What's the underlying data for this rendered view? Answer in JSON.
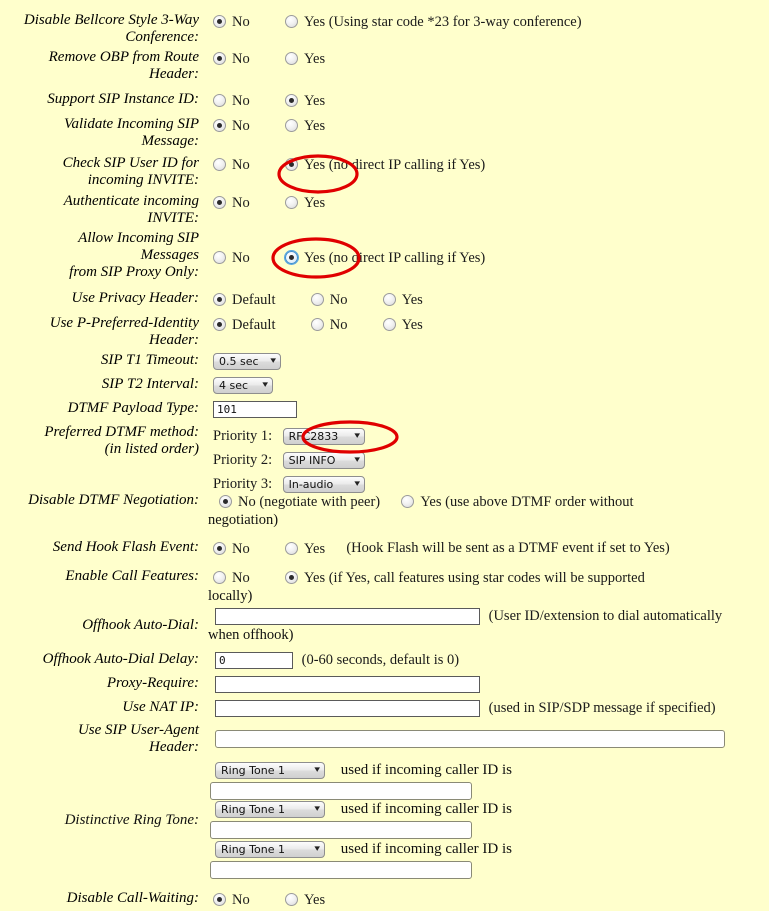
{
  "page": {
    "background_color": "#ffffcc",
    "accent_annotation_color": "#e00000",
    "focus_ring_color": "#3d8fd1"
  },
  "options": {
    "no": "No",
    "yes": "Yes",
    "default": "Default"
  },
  "rows": {
    "disable_bellcore_3way": {
      "label_lines": [
        "Disable Bellcore Style 3-Way",
        "Conference:"
      ],
      "no": "No",
      "yes": "Yes (Using star code *23 for 3-way conference)",
      "selected": "No"
    },
    "remove_obp": {
      "label_lines": [
        "Remove OBP from Route",
        "Header:"
      ],
      "no": "No",
      "yes": "Yes",
      "selected": "No"
    },
    "support_sip_instance_id": {
      "label_lines": [
        "Support SIP Instance ID:"
      ],
      "no": "No",
      "yes": "Yes",
      "selected": "Yes"
    },
    "validate_incoming_sip": {
      "label_lines": [
        "Validate Incoming SIP",
        "Message:"
      ],
      "no": "No",
      "yes": "Yes",
      "selected": "No"
    },
    "check_sip_user_id": {
      "label_lines": [
        "Check SIP User ID for",
        "incoming INVITE:"
      ],
      "no": "No",
      "yes": "Yes (no direct IP calling if Yes)",
      "selected": "Yes",
      "annotated": "true"
    },
    "authenticate_incoming_invite": {
      "label_lines": [
        "Authenticate incoming",
        "INVITE:"
      ],
      "no": "No",
      "yes": "Yes",
      "selected": "No"
    },
    "allow_incoming_sip_messages": {
      "label_lines": [
        "Allow Incoming SIP",
        "Messages",
        "from SIP Proxy Only:"
      ],
      "no": "No",
      "yes": "Yes (no direct IP calling if Yes)",
      "selected": "Yes",
      "annotated": "true",
      "focused": "true"
    },
    "use_privacy_header": {
      "label_lines": [
        "Use Privacy Header:"
      ],
      "default": "Default",
      "no": "No",
      "yes": "Yes",
      "selected": "Default"
    },
    "use_p_preferred_identity": {
      "label_lines": [
        "Use P-Preferred-Identity",
        "Header:"
      ],
      "default": "Default",
      "no": "No",
      "yes": "Yes",
      "selected": "Default"
    },
    "sip_t1_timeout": {
      "label_lines": [
        "SIP T1 Timeout:"
      ],
      "value": "0.5 sec"
    },
    "sip_t2_interval": {
      "label_lines": [
        "SIP T2 Interval:"
      ],
      "value": "4 sec"
    },
    "dtmf_payload_type": {
      "label_lines": [
        "DTMF Payload Type:"
      ],
      "value": "101"
    },
    "preferred_dtmf_method": {
      "label_lines": [
        "Preferred DTMF method:",
        "(in listed order)"
      ],
      "priority1_label": "Priority 1:",
      "priority1_value": "RFC2833",
      "priority2_label": "Priority 2:",
      "priority2_value": "SIP INFO",
      "priority3_label": "Priority 3:",
      "priority3_value": "In-audio",
      "annotated": "true"
    },
    "disable_dtmf_negotiation": {
      "label_lines": [
        "Disable DTMF Negotiation:"
      ],
      "no": "No (negotiate with peer)",
      "yes": "Yes (use above DTMF order without",
      "yes_wrap": "negotiation)",
      "selected": "No"
    },
    "send_hook_flash_event": {
      "label_lines": [
        "Send Hook Flash Event:"
      ],
      "no": "No",
      "yes": "Yes",
      "note": "(Hook Flash will be sent as a DTMF event if set to Yes)",
      "selected": "No"
    },
    "enable_call_features": {
      "label_lines": [
        "Enable Call Features:"
      ],
      "no": "No",
      "yes": "Yes (if Yes, call features using star codes will be supported",
      "yes_wrap": "locally)",
      "selected": "Yes"
    },
    "offhook_auto_dial": {
      "label_lines": [
        "Offhook Auto-Dial:"
      ],
      "value": "",
      "note": "(User ID/extension to dial automatically",
      "note_wrap": "when offhook)"
    },
    "offhook_auto_dial_delay": {
      "label_lines": [
        "Offhook Auto-Dial Delay:"
      ],
      "value": "0",
      "note": "(0-60 seconds, default is 0)"
    },
    "proxy_require": {
      "label_lines": [
        "Proxy-Require:"
      ],
      "value": ""
    },
    "use_nat_ip": {
      "label_lines": [
        "Use NAT IP:"
      ],
      "value": "",
      "note": "(used in SIP/SDP message if specified)"
    },
    "use_sip_user_agent_header": {
      "label_lines": [
        "Use SIP User-Agent",
        "Header:"
      ],
      "value": ""
    },
    "distinctive_ring_tone": {
      "label_lines": [
        "Distinctive Ring Tone:"
      ],
      "entries": [
        {
          "tone": "Ring Tone 1",
          "note": "used if incoming caller ID is",
          "caller_id": ""
        },
        {
          "tone": "Ring Tone 1",
          "note": "used if incoming caller ID is",
          "caller_id": ""
        },
        {
          "tone": "Ring Tone 1",
          "note": "used if incoming caller ID is",
          "caller_id": ""
        }
      ]
    },
    "disable_call_waiting": {
      "label_lines": [
        "Disable Call-Waiting:"
      ],
      "no": "No",
      "yes": "Yes",
      "selected": "No"
    }
  }
}
